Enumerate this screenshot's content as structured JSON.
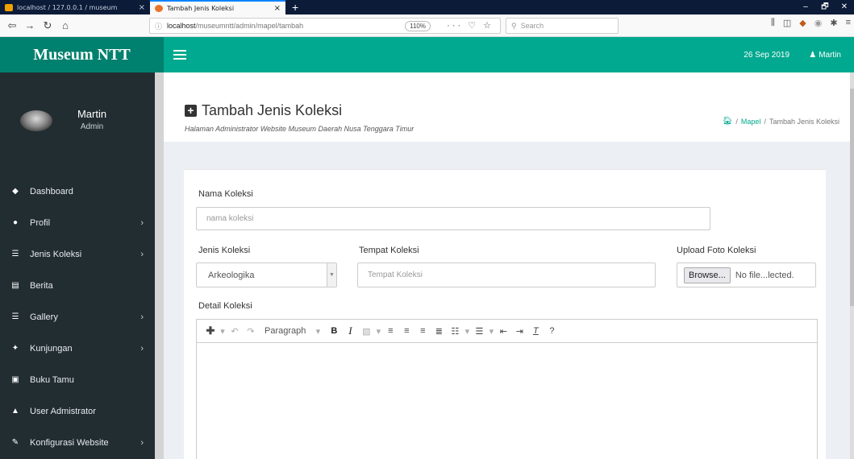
{
  "browser": {
    "tabs": [
      {
        "title": "localhost / 127.0.0.1 / museum",
        "close": "×",
        "active": false
      },
      {
        "title": "Tambah Jenis Koleksi",
        "close": "×",
        "active": true
      }
    ],
    "new_tab": "+",
    "url_host": "localhost",
    "url_path": "/museumntt/admin/mapel/tambah",
    "zoom": "110%",
    "search_placeholder": "Search",
    "window_controls": [
      "–",
      "🗗",
      "✕"
    ]
  },
  "app": {
    "logo": "Museum NTT",
    "date": "26 Sep 2019",
    "header_user": "Martin"
  },
  "sidebar": {
    "user_name": "Martin",
    "user_role": "Admin",
    "items": [
      {
        "label": "Dashboard",
        "icon": "dashboard-icon",
        "glyph": "◆",
        "has_children": false
      },
      {
        "label": "Profil",
        "icon": "profile-icon",
        "glyph": "●",
        "has_children": true
      },
      {
        "label": "Jenis Koleksi",
        "icon": "list-icon",
        "glyph": "☰",
        "has_children": true
      },
      {
        "label": "Berita",
        "icon": "newspaper-icon",
        "glyph": "▤",
        "has_children": false
      },
      {
        "label": "Gallery",
        "icon": "gallery-icon",
        "glyph": "☰",
        "has_children": true
      },
      {
        "label": "Kunjungan",
        "icon": "visit-icon",
        "glyph": "✦",
        "has_children": true
      },
      {
        "label": "Buku Tamu",
        "icon": "guestbook-icon",
        "glyph": "▣",
        "has_children": false
      },
      {
        "label": "User Admistrator",
        "icon": "lock-icon",
        "glyph": "🔒",
        "has_children": false
      },
      {
        "label": "Konfigurasi Website",
        "icon": "wrench-icon",
        "glyph": "✎",
        "has_children": true
      }
    ],
    "chevron": "›"
  },
  "page": {
    "title": "Tambah Jenis Koleksi",
    "subtitle": "Halaman Administrator Website Museum Daerah Nusa Tenggara Timur",
    "breadcrumb": [
      {
        "label": "Mapel",
        "link": true
      },
      {
        "label": "Tambah Jenis Koleksi",
        "link": false
      }
    ],
    "breadcrumb_sep": "/"
  },
  "form": {
    "nama_label": "Nama Koleksi",
    "nama_placeholder": "nama koleksi",
    "jenis_label": "Jenis Koleksi",
    "jenis_value": "Arkeologika",
    "tempat_label": "Tempat Koleksi",
    "tempat_placeholder": "Tempat Koleksi",
    "upload_label": "Upload Foto Koleksi",
    "browse_label": "Browse...",
    "file_status": "No file...lected.",
    "detail_label": "Detail Koleksi",
    "editor_format": "Paragraph"
  },
  "colors": {
    "header": "#00a98f",
    "logo_bg": "#00806e",
    "sidebar_bg": "#222d32",
    "content_bg": "#ecf0f5"
  }
}
